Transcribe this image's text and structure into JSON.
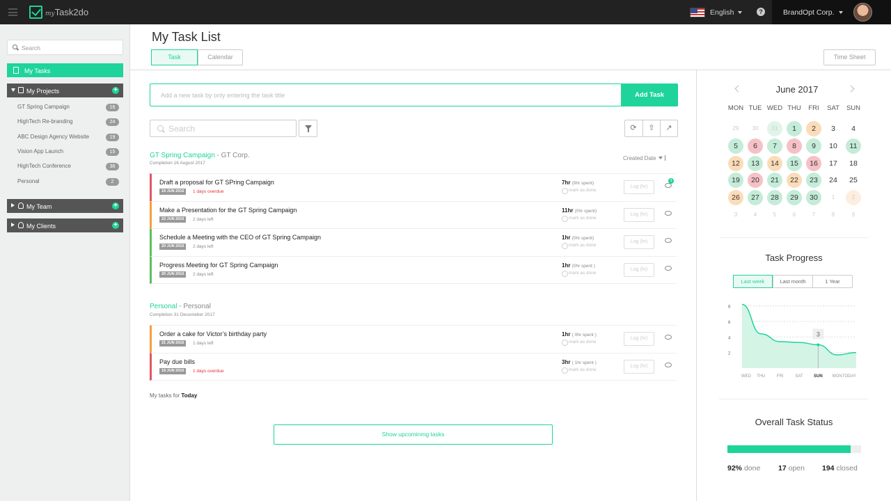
{
  "topbar": {
    "logo_prefix": "my",
    "logo_text": "Task2do",
    "language": "English",
    "help_label": "?",
    "company": "BrandOpt Corp."
  },
  "sidebar": {
    "search_placeholder": "Search",
    "my_tasks": "My Tasks",
    "my_projects": "My Projects",
    "projects": [
      {
        "name": "GT Spring Campaign",
        "count": "16"
      },
      {
        "name": "HighTech Re-branding",
        "count": "24"
      },
      {
        "name": "ABC Design Agency Website",
        "count": "19"
      },
      {
        "name": "Vision App Launch",
        "count": "15"
      },
      {
        "name": "HighTech Conference",
        "count": "36"
      },
      {
        "name": "Personal",
        "count": "2"
      }
    ],
    "my_team": "My Team",
    "my_clients": "My Clients"
  },
  "main": {
    "title": "My Task List",
    "tabs": [
      "Task",
      "Calendar"
    ],
    "time_sheet": "Time Sheet",
    "add_placeholder": "Add a new task by only entering the task title",
    "add_button": "Add Task",
    "search_placeholder": "Search",
    "sort_label": "Created Date",
    "groups": [
      {
        "name": "GT Spring Campaign",
        "client": "- GT Corp.",
        "completion": "Completion 16 August 2017",
        "tasks": [
          {
            "title": "Draft a proposal for GT SPring Campaign",
            "date": "19 JUN 2016",
            "due": "1 days overdue",
            "status": "overdue",
            "hours": "7hr",
            "spent": "(9hr spent)",
            "mark": "mark as done",
            "log": "Log (hr)",
            "comments": "3",
            "color": "#e05563"
          },
          {
            "title": "Make a Presentation for the GT Spring Campaign",
            "date": "22 JUN 2016",
            "due": "2 days left",
            "status": "left",
            "hours": "11hr",
            "spent": "(0hr spent)",
            "mark": "mark as done",
            "log": "Log (hr)",
            "comments": "",
            "color": "#f5a03a"
          },
          {
            "title": "Schedule a Meeting with the CEO of GT Spring Campaign",
            "date": "20 JUN 2016",
            "due": "2 days left",
            "status": "left",
            "hours": "1hr",
            "spent": "(0hr spent)",
            "mark": "mark as done",
            "log": "Log (hr)",
            "comments": "",
            "color": "#5cbf5e"
          },
          {
            "title": "Progress Meeting for GT Spring Campaign",
            "date": "20 JUN 2016",
            "due": "2 days left",
            "status": "left",
            "hours": "1hr",
            "spent": "(0hr spent )",
            "mark": "mark as done",
            "log": "Log (hr)",
            "comments": "",
            "color": "#5cbf5e"
          }
        ]
      },
      {
        "name": "Personal",
        "client": "- Personal",
        "completion": "Completion 31 Decemeber 2017",
        "tasks": [
          {
            "title": "Order a cake for Victor’s birthday party",
            "date": "21 JUN 2016",
            "due": "1 days left",
            "status": "left",
            "hours": "1hr",
            "spent": "( 0hr spent )",
            "mark": "mark as done",
            "log": "Log (hr)",
            "comments": "",
            "color": "#f5a03a"
          },
          {
            "title": "Pay due bills",
            "date": "19 JUN 2016",
            "due": "1 days overdue",
            "status": "overdue",
            "hours": "3hr",
            "spent": "( 1hr spent )",
            "mark": "mark as done",
            "log": "Log (hr)",
            "comments": "",
            "color": "#e05563"
          }
        ]
      }
    ],
    "today_prefix": "My tasks for",
    "today_label": "Today",
    "show_upcoming": "Show upcominmg tasks"
  },
  "calendar": {
    "month": "June 2017",
    "weekdays": [
      "MON",
      "TUE",
      "WED",
      "THU",
      "FRI",
      "SAT",
      "SUN"
    ],
    "weeks": [
      [
        {
          "d": "29",
          "s": "faded"
        },
        {
          "d": "30",
          "s": "faded"
        },
        {
          "d": "31",
          "s": "faded g"
        },
        {
          "d": "1",
          "s": "g"
        },
        {
          "d": "2",
          "s": "o"
        },
        {
          "d": "3",
          "s": ""
        },
        {
          "d": "4",
          "s": ""
        }
      ],
      [
        {
          "d": "5",
          "s": "g"
        },
        {
          "d": "6",
          "s": "r"
        },
        {
          "d": "7",
          "s": "g"
        },
        {
          "d": "8",
          "s": "r"
        },
        {
          "d": "9",
          "s": "g"
        },
        {
          "d": "10",
          "s": ""
        },
        {
          "d": "11",
          "s": "g"
        }
      ],
      [
        {
          "d": "12",
          "s": "o"
        },
        {
          "d": "13",
          "s": "g"
        },
        {
          "d": "14",
          "s": "o"
        },
        {
          "d": "15",
          "s": "g"
        },
        {
          "d": "16",
          "s": "r"
        },
        {
          "d": "17",
          "s": ""
        },
        {
          "d": "18",
          "s": ""
        }
      ],
      [
        {
          "d": "19",
          "s": "g"
        },
        {
          "d": "20",
          "s": "r"
        },
        {
          "d": "21",
          "s": "g"
        },
        {
          "d": "22",
          "s": "o"
        },
        {
          "d": "23",
          "s": "g"
        },
        {
          "d": "24",
          "s": ""
        },
        {
          "d": "25",
          "s": ""
        }
      ],
      [
        {
          "d": "26",
          "s": "o"
        },
        {
          "d": "27",
          "s": "g"
        },
        {
          "d": "28",
          "s": "g"
        },
        {
          "d": "29",
          "s": "g"
        },
        {
          "d": "30",
          "s": "g"
        },
        {
          "d": "1",
          "s": "faded"
        },
        {
          "d": "2",
          "s": "faded o"
        }
      ],
      [
        {
          "d": "3",
          "s": "faded"
        },
        {
          "d": "4",
          "s": "faded"
        },
        {
          "d": "5",
          "s": "faded"
        },
        {
          "d": "6",
          "s": "faded"
        },
        {
          "d": "7",
          "s": "faded"
        },
        {
          "d": "8",
          "s": "faded"
        },
        {
          "d": "9",
          "s": "faded"
        }
      ]
    ]
  },
  "progress": {
    "title": "Task Progress",
    "tabs": [
      "Last week",
      "Last month",
      "1 Year"
    ],
    "chart_data": {
      "type": "area",
      "categories": [
        "WED",
        "THU",
        "FRI",
        "SAT",
        "SUN",
        "MON",
        "TODAY"
      ],
      "values": [
        8.2,
        4.4,
        3.4,
        3.3,
        3.0,
        1.7,
        2.0
      ],
      "y_ticks": [
        "8",
        "6",
        "4",
        "2"
      ],
      "ylim": [
        0,
        8.5
      ],
      "highlight_index": 4,
      "highlight_label": "3"
    }
  },
  "status": {
    "title": "Overall Task Status",
    "done_fraction": 0.92,
    "done_value": "92%",
    "done_label": "done",
    "open_value": "17",
    "open_label": "open",
    "closed_value": "194",
    "closed_label": "closed"
  },
  "colors": {
    "accent": "#1ed49a",
    "topbar": "#222222",
    "overdue": "#dd3333"
  }
}
